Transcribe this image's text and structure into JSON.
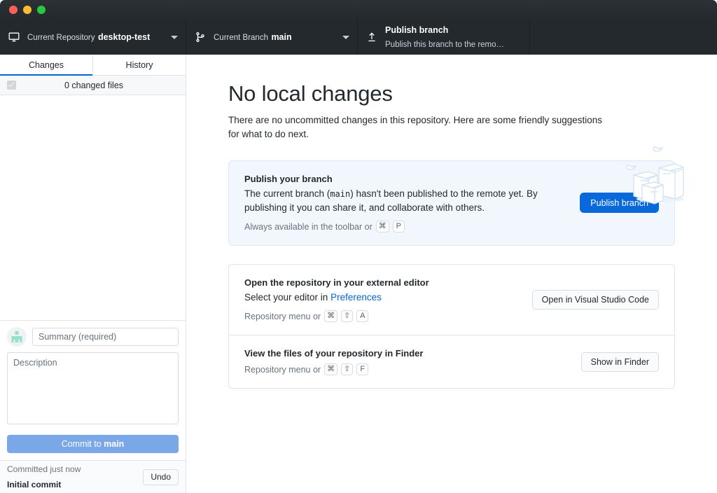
{
  "window": {
    "traffic_lights": [
      "close",
      "minimize",
      "zoom"
    ]
  },
  "toolbar": {
    "repository": {
      "icon": "desktop-repository-icon",
      "label": "Current Repository",
      "value": "desktop-test"
    },
    "branch": {
      "icon": "git-branch-icon",
      "label": "Current Branch",
      "value": "main"
    },
    "publish": {
      "icon": "publish-upload-icon",
      "title": "Publish branch",
      "subtitle": "Publish this branch to the remo…"
    }
  },
  "sidebar": {
    "tabs": [
      {
        "id": "changes",
        "label": "Changes",
        "active": true
      },
      {
        "id": "history",
        "label": "History",
        "active": false
      }
    ],
    "changed_files_text": "0 changed files",
    "commit": {
      "summary_placeholder": "Summary (required)",
      "summary_value": "",
      "description_placeholder": "Description",
      "description_value": "",
      "commit_button_prefix": "Commit to ",
      "commit_button_branch": "main"
    },
    "status": {
      "line1": "Committed just now",
      "line2": "Initial commit",
      "undo_label": "Undo"
    }
  },
  "main": {
    "title": "No local changes",
    "subtitle": "There are no uncommitted changes in this repository. Here are some friendly suggestions for what to do next.",
    "cards": [
      {
        "id": "publish-branch",
        "title": "Publish your branch",
        "desc_part1": "The current branch (",
        "desc_code": "main",
        "desc_part2": ") hasn't been published to the remote yet. By publishing it you can share it, and collaborate with others.",
        "hint_text": "Always available in the toolbar or",
        "hint_keys": [
          "⌘",
          "P"
        ],
        "action_label": "Publish branch"
      },
      {
        "id": "open-external-editor",
        "title": "Open the repository in your external editor",
        "desc_prefix": "Select your editor in ",
        "desc_link": "Preferences",
        "hint_text": "Repository menu or",
        "hint_keys": [
          "⌘",
          "⇧",
          "A"
        ],
        "action_label": "Open in Visual Studio Code"
      },
      {
        "id": "show-in-finder",
        "title": "View the files of your repository in Finder",
        "hint_text": "Repository menu or",
        "hint_keys": [
          "⌘",
          "⇧",
          "F"
        ],
        "action_label": "Show in Finder"
      }
    ]
  },
  "colors": {
    "toolbar_bg": "#24292e",
    "accent_blue": "#0969da",
    "tab_underline": "#0366d6",
    "commit_button": "#7aa7e8",
    "highlight_card_bg": "#f2f7fd",
    "link": "#0366d6"
  }
}
